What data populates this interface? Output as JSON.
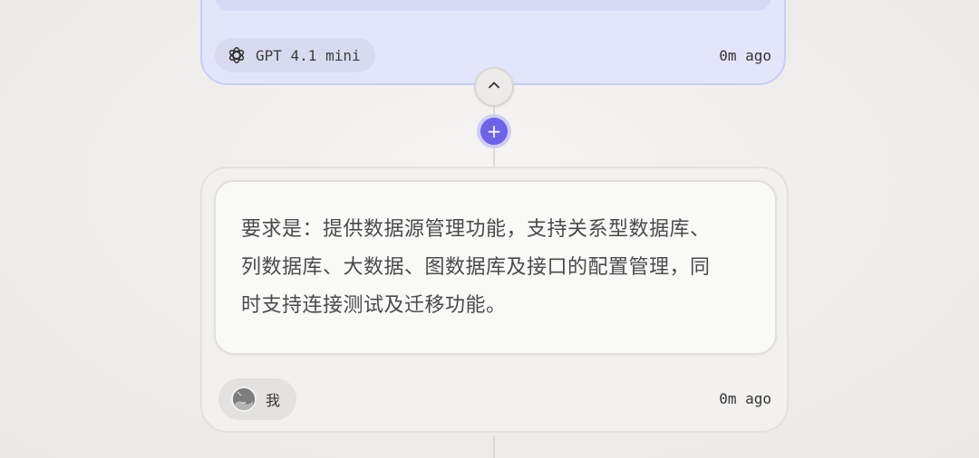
{
  "ai_message": {
    "model_name": "GPT 4.1 mini",
    "timestamp": "0m ago",
    "model_icon": "openai-logo-icon"
  },
  "controls": {
    "collapse_icon": "chevron-up-icon",
    "add_icon": "plus-icon",
    "add_glyph": "+"
  },
  "user_message": {
    "lines": [
      "要求是：提供数据源管理功能，支持关系型数据库、",
      "列数据库、大数据、图数据库及接口的配置管理，同",
      "时支持连接测试及迁移功能。"
    ],
    "author": "我",
    "timestamp": "0m ago",
    "avatar_icon": "avatar-icon"
  },
  "colors": {
    "accent": "#6c63e6",
    "ai_card_bg": "#e3e5fa",
    "ai_card_border": "#c9ccf6",
    "user_card_bg": "#f2f1f0"
  }
}
